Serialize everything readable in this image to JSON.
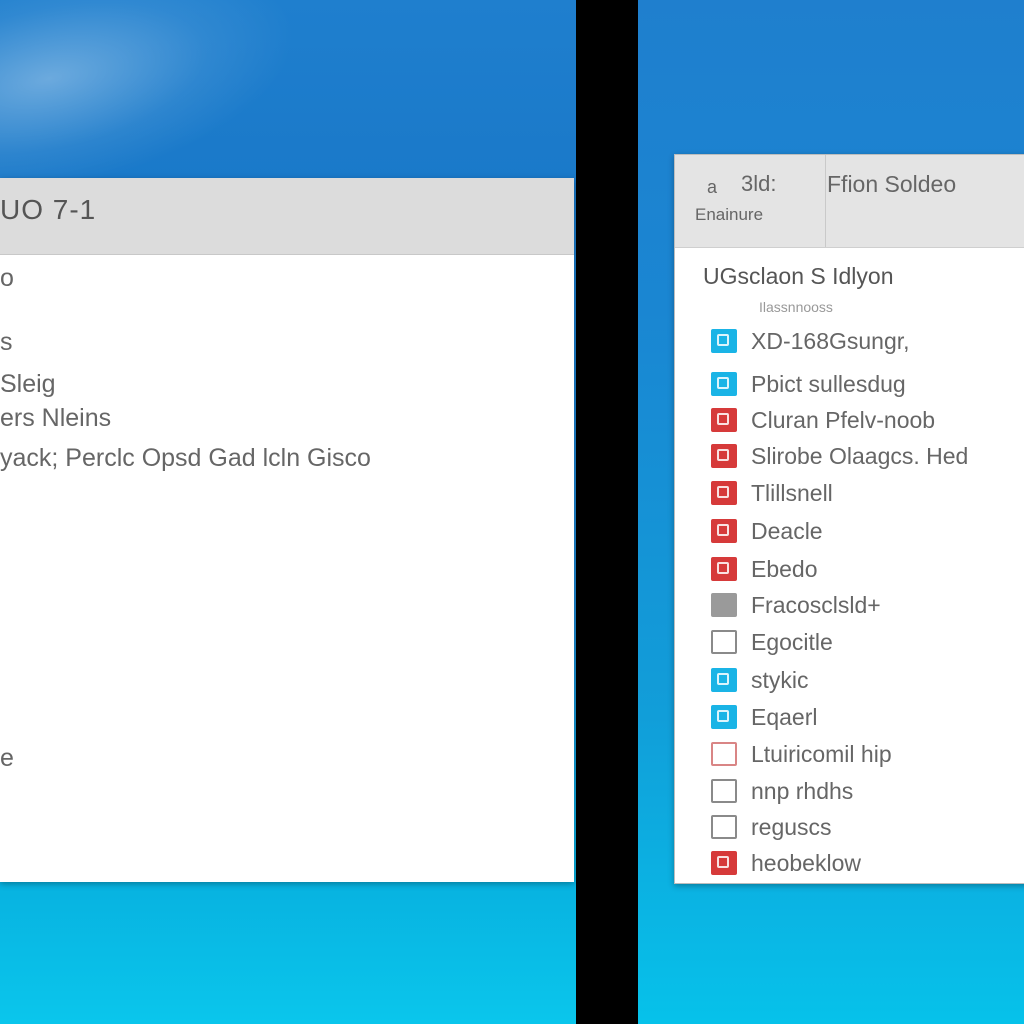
{
  "left_window": {
    "title": "UO 7-1",
    "lines": [
      "o",
      "s",
      "Sleig",
      "ers Nleins",
      "yack; Perclc Opsd Gad lcln Gisco",
      "e"
    ]
  },
  "right_window": {
    "toolbar": {
      "label_a": "a",
      "label_b": "3ld:",
      "label_c": "Enainure",
      "title": "Ffion Soldeo"
    },
    "heading": "UGsclaon S Idlyon",
    "subheading": "Ilassnnooss",
    "items": [
      {
        "label": "XD-168Gsungr,",
        "icon": "cyan-icon"
      },
      {
        "label": "Pbict sullesdug",
        "icon": "cyan-icon"
      },
      {
        "label": "Cluran Pfelv-noob",
        "icon": "red-icon"
      },
      {
        "label": "Slirobe Olaagcs. Hed",
        "icon": "red-icon"
      },
      {
        "label": "Tlillsnell",
        "icon": "red-icon"
      },
      {
        "label": "Deacle",
        "icon": "red-icon"
      },
      {
        "label": "Ebedo",
        "icon": "red-icon"
      },
      {
        "label": "Fracosclsld+",
        "icon": "gray-icon"
      },
      {
        "label": "Egocitle",
        "icon": "outline-icon"
      },
      {
        "label": "stykic",
        "icon": "cyan-icon"
      },
      {
        "label": "Eqaerl",
        "icon": "cyan-icon"
      },
      {
        "label": "Ltuiricomil hip",
        "icon": "red-icon"
      },
      {
        "label": "nnp rhdhs",
        "icon": "outline-icon"
      },
      {
        "label": "reguscs",
        "icon": "outline-icon"
      },
      {
        "label": "heobeklow",
        "icon": "red-icon"
      }
    ]
  },
  "colors": {
    "desktop_blue": "#1a79c9",
    "desktop_cyan": "#0ac6ec",
    "window_bg": "#ffffff",
    "titlebar_gray": "#dcdcdc",
    "icon_red": "#d63a3a",
    "icon_cyan": "#1ab4e6"
  }
}
